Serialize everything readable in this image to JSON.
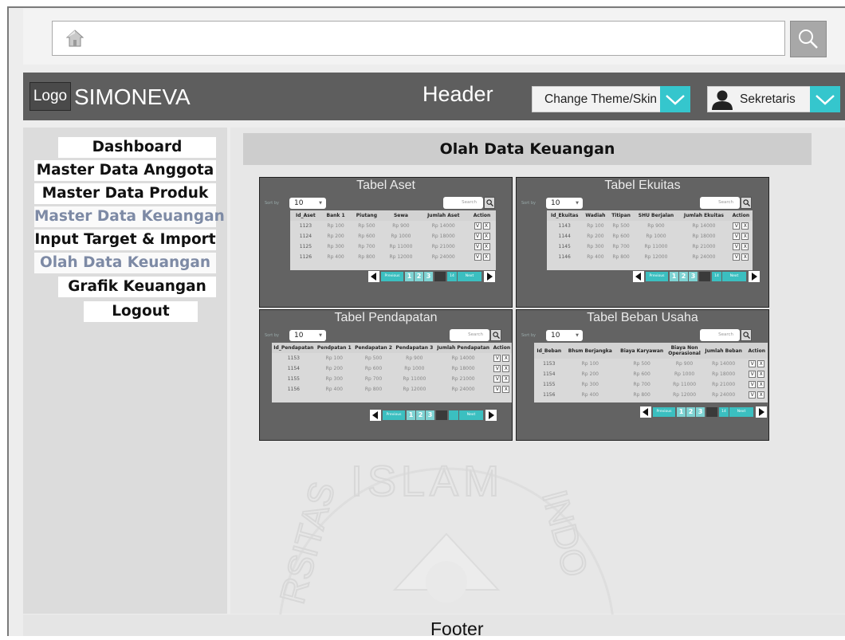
{
  "browser": {
    "url_value": ""
  },
  "header": {
    "logo": "Logo",
    "app_name": "SIMONEVA",
    "label": "Header",
    "theme_button": "Change Theme/Skin",
    "user_button": "Sekretaris"
  },
  "sidebar": {
    "items": [
      {
        "label": "Dashboard"
      },
      {
        "label": "Master Data Anggota"
      },
      {
        "label": "Master Data Produk"
      },
      {
        "label": "Master Data Keuangan"
      },
      {
        "label": "Input Target & Import"
      },
      {
        "label": "Olah Data Keuangan"
      },
      {
        "label": "Grafik Keuangan"
      },
      {
        "label": "Logout"
      }
    ]
  },
  "main": {
    "title": "Olah Data Keuangan",
    "panels": [
      {
        "title": "Tabel Aset",
        "sort_label": "Sort by",
        "entries": "10",
        "search_placeholder": "Search",
        "columns": [
          "Id_Aset",
          "Bank 1",
          "Piutang",
          "Sewa",
          "Jumlah Aset",
          "Action"
        ],
        "rows": [
          [
            "1123",
            "Rp 100",
            "Rp 500",
            "Rp 900",
            "Rp 14000"
          ],
          [
            "1124",
            "Rp 200",
            "Rp 600",
            "Rp 1000",
            "Rp 18000"
          ],
          [
            "1125",
            "Rp 300",
            "Rp 700",
            "Rp 11000",
            "Rp 21000"
          ],
          [
            "1126",
            "Rp 400",
            "Rp 800",
            "Rp 12000",
            "Rp 24000"
          ]
        ],
        "pager": {
          "previous": "Previous",
          "pages": [
            "1",
            "2",
            "3"
          ],
          "jump": "14",
          "next": "Next"
        }
      },
      {
        "title": "Tabel Ekuitas",
        "sort_label": "Sort by",
        "entries": "10",
        "search_placeholder": "Search",
        "columns": [
          "Id_Ekuitas",
          "Wadiah",
          "Titipan",
          "SHU Berjalan",
          "Jumlah Ekuitas",
          "Action"
        ],
        "rows": [
          [
            "1143",
            "Rp 100",
            "Rp 500",
            "Rp 900",
            "Rp 14000"
          ],
          [
            "1144",
            "Rp 200",
            "Rp 600",
            "Rp 1000",
            "Rp 18000"
          ],
          [
            "1145",
            "Rp 300",
            "Rp 700",
            "Rp 11000",
            "Rp 21000"
          ],
          [
            "1146",
            "Rp 400",
            "Rp 800",
            "Rp 12000",
            "Rp 24000"
          ]
        ],
        "pager": {
          "previous": "Previous",
          "pages": [
            "1",
            "2",
            "3"
          ],
          "jump": "14",
          "next": "Next"
        }
      },
      {
        "title": "Tabel Pendapatan",
        "sort_label": "Sort by",
        "entries": "10",
        "search_placeholder": "Search",
        "columns": [
          "Id_Pendapatan",
          "Pendpatan 1",
          "Pendapatan 2",
          "Pendapatan 3",
          "Jumlah Pendapatan",
          "Action"
        ],
        "rows": [
          [
            "1153",
            "Rp 100",
            "Rp 500",
            "Rp 900",
            "Rp 14000"
          ],
          [
            "1154",
            "Rp 200",
            "Rp 600",
            "Rp 1000",
            "Rp 18000"
          ],
          [
            "1155",
            "Rp 300",
            "Rp 700",
            "Rp 11000",
            "Rp 21000"
          ],
          [
            "1156",
            "Rp 400",
            "Rp 800",
            "Rp 12000",
            "Rp 24000"
          ]
        ],
        "pager": {
          "previous": "Previous",
          "pages": [
            "1",
            "2",
            "3"
          ],
          "jump": "",
          "next": "Next"
        }
      },
      {
        "title": "Tabel Beban Usaha",
        "sort_label": "Sort by",
        "entries": "10",
        "search_placeholder": "Search",
        "columns": [
          "Id_Beban",
          "Bhsm Berjangka",
          "Biaya Karyawan",
          "Biaya Non Operasional",
          "Jumlah Beban",
          "Action"
        ],
        "rows": [
          [
            "1153",
            "Rp 100",
            "Rp 500",
            "Rp 900",
            "Rp 14000"
          ],
          [
            "1154",
            "Rp 200",
            "Rp 600",
            "Rp 1000",
            "Rp 18000"
          ],
          [
            "1155",
            "Rp 300",
            "Rp 700",
            "Rp 11000",
            "Rp 21000"
          ],
          [
            "1156",
            "Rp 400",
            "Rp 800",
            "Rp 12000",
            "Rp 24000"
          ]
        ],
        "pager": {
          "previous": "Previous",
          "pages": [
            "1",
            "2",
            "3"
          ],
          "jump": "14",
          "next": "Next"
        }
      }
    ],
    "action_labels": {
      "edit": "V",
      "delete": "X"
    }
  },
  "watermark": {
    "text": "ISLAM INDO RSITAS"
  },
  "footer": {
    "label": "Footer"
  },
  "colors": {
    "accent": "#35c6cd",
    "header_bg": "#5e5e5e",
    "panel_bg": "#636363"
  },
  "icons": {
    "home": "home-icon",
    "search": "search-icon",
    "chevron": "chevron-down-icon",
    "user": "user-icon"
  }
}
